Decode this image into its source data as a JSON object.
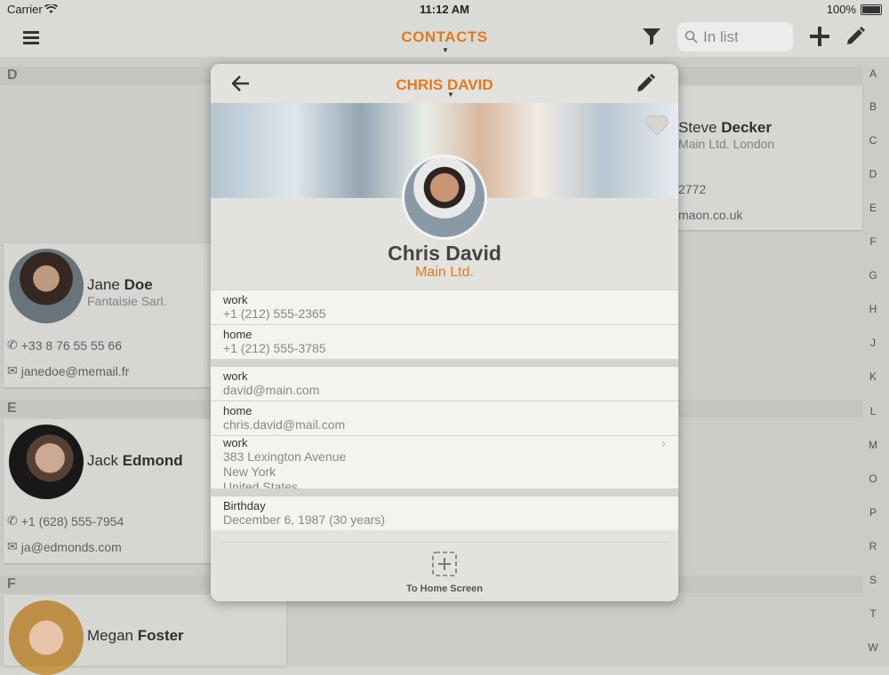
{
  "status": {
    "carrier": "Carrier",
    "time": "11:12 AM",
    "battery": "100%"
  },
  "nav": {
    "title": "CONTACTS",
    "search_placeholder": "In list"
  },
  "index_letters": [
    "A",
    "B",
    "C",
    "D",
    "E",
    "F",
    "G",
    "H",
    "J",
    "K",
    "L",
    "M",
    "O",
    "P",
    "R",
    "S",
    "T",
    "W"
  ],
  "sections": {
    "d": "D",
    "e": "E",
    "f": "F"
  },
  "contacts": [
    {
      "first": "Steve",
      "last": "Decker",
      "company": "Main Ltd. London",
      "phone": "2772",
      "email": "maon.co.uk"
    },
    {
      "first": "Jane",
      "last": "Doe",
      "company": "Fantaisie Sarl.",
      "phone": "+33 8 76 55 55 66",
      "email": "janedoe@memail.fr"
    },
    {
      "first": "Jack",
      "last": "Edmond",
      "company": "",
      "phone": "+1 (628) 555-7954",
      "email": "ja@edmonds.com"
    },
    {
      "first": "Megan",
      "last": "Foster",
      "company": "",
      "phone": "",
      "email": ""
    }
  ],
  "detail": {
    "title": "CHRIS DAVID",
    "name": "Chris David",
    "company": "Main Ltd.",
    "phones": [
      {
        "label": "work",
        "value": "+1 (212) 555-2365"
      },
      {
        "label": "home",
        "value": "+1 (212) 555-3785"
      }
    ],
    "emails": [
      {
        "label": "work",
        "value": "david@main.com"
      },
      {
        "label": "home",
        "value": "chris.david@mail.com"
      }
    ],
    "address": {
      "label": "work",
      "line1": "383 Lexington Avenue",
      "line2": "New York",
      "line3": "United States"
    },
    "birthday": {
      "label": "Birthday",
      "value": "December 6, 1987 (30 years)"
    },
    "home_screen_label": "To Home Screen"
  },
  "colors": {
    "accent": "#e07a1f",
    "background": "#d6d6d3",
    "row": "#f4f3ee"
  }
}
